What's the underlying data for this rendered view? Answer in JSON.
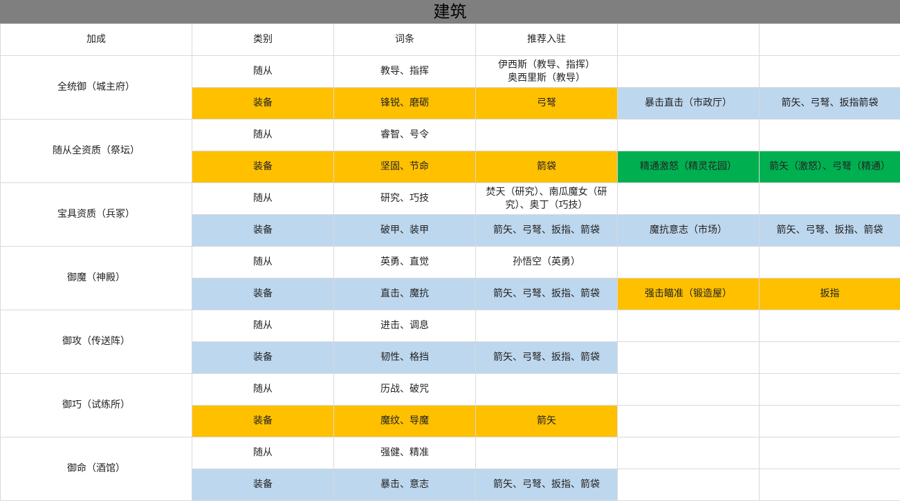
{
  "title": "建筑",
  "headers": [
    "加成",
    "类别",
    "词条",
    "推荐入驻",
    "",
    ""
  ],
  "groups": [
    {
      "bonus": "全统御（城主府）",
      "rows": [
        {
          "category": "随从",
          "entry": "教导、指挥",
          "recommend": "伊西斯（教导、指挥）\n奥西里斯（教导）",
          "extra1": "",
          "extra2": "",
          "colors": [
            "#ffffff",
            "#ffffff",
            "#ffffff",
            "#ffffff",
            "#ffffff"
          ]
        },
        {
          "category": "装备",
          "entry": "锋锐、磨砺",
          "recommend": "弓弩",
          "extra1": "暴击直击（市政厅）",
          "extra2": "箭矢、弓弩、扳指箭袋",
          "colors": [
            "#ffc000",
            "#ffc000",
            "#ffc000",
            "#bdd7ee",
            "#bdd7ee"
          ]
        }
      ]
    },
    {
      "bonus": "随从全资质（祭坛）",
      "rows": [
        {
          "category": "随从",
          "entry": "睿智、号令",
          "recommend": "",
          "extra1": "",
          "extra2": "",
          "colors": [
            "#ffffff",
            "#ffffff",
            "#ffffff",
            "#ffffff",
            "#ffffff"
          ]
        },
        {
          "category": "装备",
          "entry": "坚固、节命",
          "recommend": "箭袋",
          "extra1": "精通激怒（精灵花园）",
          "extra2": "箭矢（激怒）、弓弩（精通）",
          "colors": [
            "#ffc000",
            "#ffc000",
            "#ffc000",
            "#00b050",
            "#00b050"
          ]
        }
      ]
    },
    {
      "bonus": "宝具资质（兵冢）",
      "rows": [
        {
          "category": "随从",
          "entry": "研究、巧技",
          "recommend": "焚天（研究）、南瓜魔女（研究）、奥丁（巧技）",
          "extra1": "",
          "extra2": "",
          "colors": [
            "#ffffff",
            "#ffffff",
            "#ffffff",
            "#ffffff",
            "#ffffff"
          ]
        },
        {
          "category": "装备",
          "entry": "破甲、装甲",
          "recommend": "箭矢、弓弩、扳指、箭袋",
          "extra1": "魔抗意志（市场）",
          "extra2": "箭矢、弓弩、扳指、箭袋",
          "colors": [
            "#bdd7ee",
            "#bdd7ee",
            "#bdd7ee",
            "#bdd7ee",
            "#bdd7ee"
          ]
        }
      ]
    },
    {
      "bonus": "御魔（神殿）",
      "rows": [
        {
          "category": "随从",
          "entry": "英勇、直觉",
          "recommend": "孙悟空（英勇）",
          "extra1": "",
          "extra2": "",
          "colors": [
            "#ffffff",
            "#ffffff",
            "#ffffff",
            "#ffffff",
            "#ffffff"
          ]
        },
        {
          "category": "装备",
          "entry": "直击、魔抗",
          "recommend": "箭矢、弓弩、扳指、箭袋",
          "extra1": "强击瞄准（锻造屋）",
          "extra2": "扳指",
          "colors": [
            "#bdd7ee",
            "#bdd7ee",
            "#bdd7ee",
            "#ffc000",
            "#ffc000"
          ]
        }
      ]
    },
    {
      "bonus": "御攻（传送阵）",
      "rows": [
        {
          "category": "随从",
          "entry": "进击、调息",
          "recommend": "",
          "extra1": "",
          "extra2": "",
          "colors": [
            "#ffffff",
            "#ffffff",
            "#ffffff",
            "#ffffff",
            "#ffffff"
          ]
        },
        {
          "category": "装备",
          "entry": "韧性、格挡",
          "recommend": "箭矢、弓弩、扳指、箭袋",
          "extra1": "",
          "extra2": "",
          "colors": [
            "#bdd7ee",
            "#bdd7ee",
            "#bdd7ee",
            "#ffffff",
            "#ffffff"
          ]
        }
      ]
    },
    {
      "bonus": "御巧（试练所）",
      "rows": [
        {
          "category": "随从",
          "entry": "历战、破咒",
          "recommend": "",
          "extra1": "",
          "extra2": "",
          "colors": [
            "#ffffff",
            "#ffffff",
            "#ffffff",
            "#ffffff",
            "#ffffff"
          ]
        },
        {
          "category": "装备",
          "entry": "魔纹、导魔",
          "recommend": "箭矢",
          "extra1": "",
          "extra2": "",
          "colors": [
            "#ffc000",
            "#ffc000",
            "#ffc000",
            "#ffffff",
            "#ffffff"
          ]
        }
      ]
    },
    {
      "bonus": "御命（酒馆）",
      "rows": [
        {
          "category": "随从",
          "entry": "强健、精准",
          "recommend": "",
          "extra1": "",
          "extra2": "",
          "colors": [
            "#ffffff",
            "#ffffff",
            "#ffffff",
            "#ffffff",
            "#ffffff"
          ]
        },
        {
          "category": "装备",
          "entry": "暴击、意志",
          "recommend": "箭矢、弓弩、扳指、箭袋",
          "extra1": "",
          "extra2": "",
          "colors": [
            "#bdd7ee",
            "#bdd7ee",
            "#bdd7ee",
            "#ffffff",
            "#ffffff"
          ]
        }
      ]
    }
  ]
}
